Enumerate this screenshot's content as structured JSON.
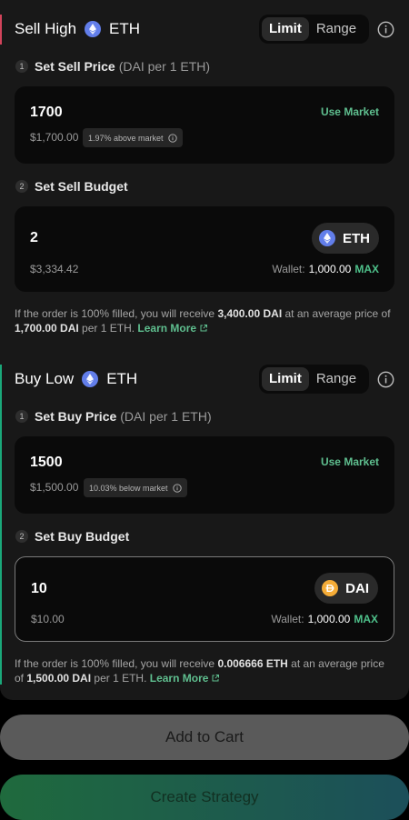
{
  "sell": {
    "title": "Sell High",
    "token": "ETH",
    "toggle": {
      "limit": "Limit",
      "range": "Range"
    },
    "step1": {
      "num": "1",
      "label": "Set Sell Price",
      "sub": "(DAI per 1 ETH)"
    },
    "price": {
      "value": "1700",
      "usd": "$1,700.00",
      "pill": "1.97% above market",
      "use_market": "Use Market"
    },
    "step2": {
      "num": "2",
      "label": "Set Sell Budget"
    },
    "budget": {
      "value": "2",
      "usd": "$3,334.42",
      "token": "ETH",
      "wallet_label": "Wallet:",
      "wallet_value": "1,000.00",
      "max": "MAX"
    },
    "note": {
      "pre": "If the order is 100% filled, you will receive ",
      "amount": "3,400.00 DAI",
      "mid": " at an average price of ",
      "price": "1,700.00 DAI",
      "post": " per 1 ETH. ",
      "learn": "Learn More"
    }
  },
  "buy": {
    "title": "Buy Low",
    "token": "ETH",
    "toggle": {
      "limit": "Limit",
      "range": "Range"
    },
    "step1": {
      "num": "1",
      "label": "Set Buy Price",
      "sub": "(DAI per 1 ETH)"
    },
    "price": {
      "value": "1500",
      "usd": "$1,500.00",
      "pill": "10.03% below market",
      "use_market": "Use Market"
    },
    "step2": {
      "num": "2",
      "label": "Set Buy Budget"
    },
    "budget": {
      "value": "10",
      "usd": "$10.00",
      "token": "DAI",
      "wallet_label": "Wallet:",
      "wallet_value": "1,000.00",
      "max": "MAX"
    },
    "note": {
      "pre": "If the order is 100% filled, you will receive ",
      "amount": "0.006666 ETH",
      "mid": " at an average price of ",
      "price": "1,500.00 DAI",
      "post": " per 1 ETH. ",
      "learn": "Learn More"
    }
  },
  "actions": {
    "add_to_cart": "Add to Cart",
    "create_strategy": "Create Strategy"
  },
  "colors": {
    "sell_accent": "#d2445b",
    "buy_accent": "#1aa87a",
    "link_green": "#5fbf8f",
    "eth_blue": "#627eea",
    "dai_orange": "#f5ac37"
  },
  "icons": {
    "eth": "eth-token-icon",
    "dai": "dai-token-icon",
    "info": "info-icon",
    "external": "external-link-icon"
  }
}
